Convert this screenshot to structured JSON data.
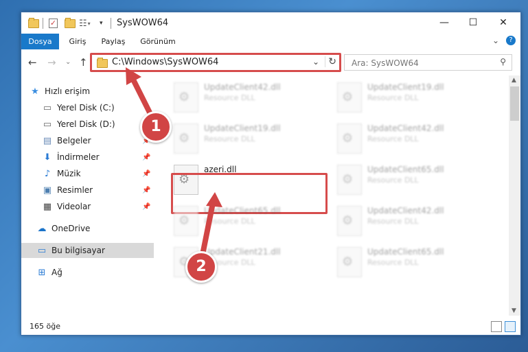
{
  "window": {
    "title": "SysWOW64",
    "controls": {
      "minimize": "—",
      "maximize": "☐",
      "close": "✕"
    }
  },
  "ribbon": {
    "tabs": [
      "Dosya",
      "Giriş",
      "Paylaş",
      "Görünüm"
    ],
    "expand_icon": "chevron-down-icon",
    "help_icon": "help-icon"
  },
  "address": {
    "path": "C:\\Windows\\SysWOW64",
    "search_placeholder": "Ara: SysWOW64"
  },
  "nav": {
    "items": [
      {
        "label": "Hızlı erişim",
        "icon": "star-icon"
      },
      {
        "label": "Yerel Disk (C:)",
        "icon": "drive-icon"
      },
      {
        "label": "Yerel Disk (D:)",
        "icon": "drive-icon"
      },
      {
        "label": "Belgeler",
        "icon": "documents-icon",
        "pinned": true
      },
      {
        "label": "İndirmeler",
        "icon": "download-icon",
        "pinned": true
      },
      {
        "label": "Müzik",
        "icon": "music-icon",
        "pinned": true
      },
      {
        "label": "Resimler",
        "icon": "pictures-icon",
        "pinned": true
      },
      {
        "label": "Videolar",
        "icon": "videos-icon",
        "pinned": true
      },
      {
        "label": "OneDrive",
        "icon": "cloud-icon"
      },
      {
        "label": "Bu bilgisayar",
        "icon": "computer-icon",
        "selected": true
      },
      {
        "label": "Ağ",
        "icon": "network-icon"
      }
    ]
  },
  "files": {
    "col1": [
      {
        "name": "UpdateClient42.dll",
        "desc": "Resource DLL"
      },
      {
        "name": "UpdateClient19.dll",
        "desc": "Resource DLL"
      },
      {
        "name": "azeri.dll",
        "desc": ""
      },
      {
        "name": "UpdateClient65.dll",
        "desc": "Resource DLL"
      },
      {
        "name": "UpdateClient21.dll",
        "desc": "Resource DLL"
      }
    ],
    "col2": [
      {
        "name": "UpdateClient19.dll",
        "desc": "Resource DLL"
      },
      {
        "name": "UpdateClient42.dll",
        "desc": "Resource DLL"
      },
      {
        "name": "UpdateClient65.dll",
        "desc": "Resource DLL"
      },
      {
        "name": "UpdateClient42.dll",
        "desc": "Resource DLL"
      },
      {
        "name": "UpdateClient65.dll",
        "desc": "Resource DLL"
      }
    ]
  },
  "status": {
    "count": "165 öğe"
  },
  "annotations": {
    "step1": "1",
    "step2": "2",
    "accent": "#d64c4c"
  }
}
